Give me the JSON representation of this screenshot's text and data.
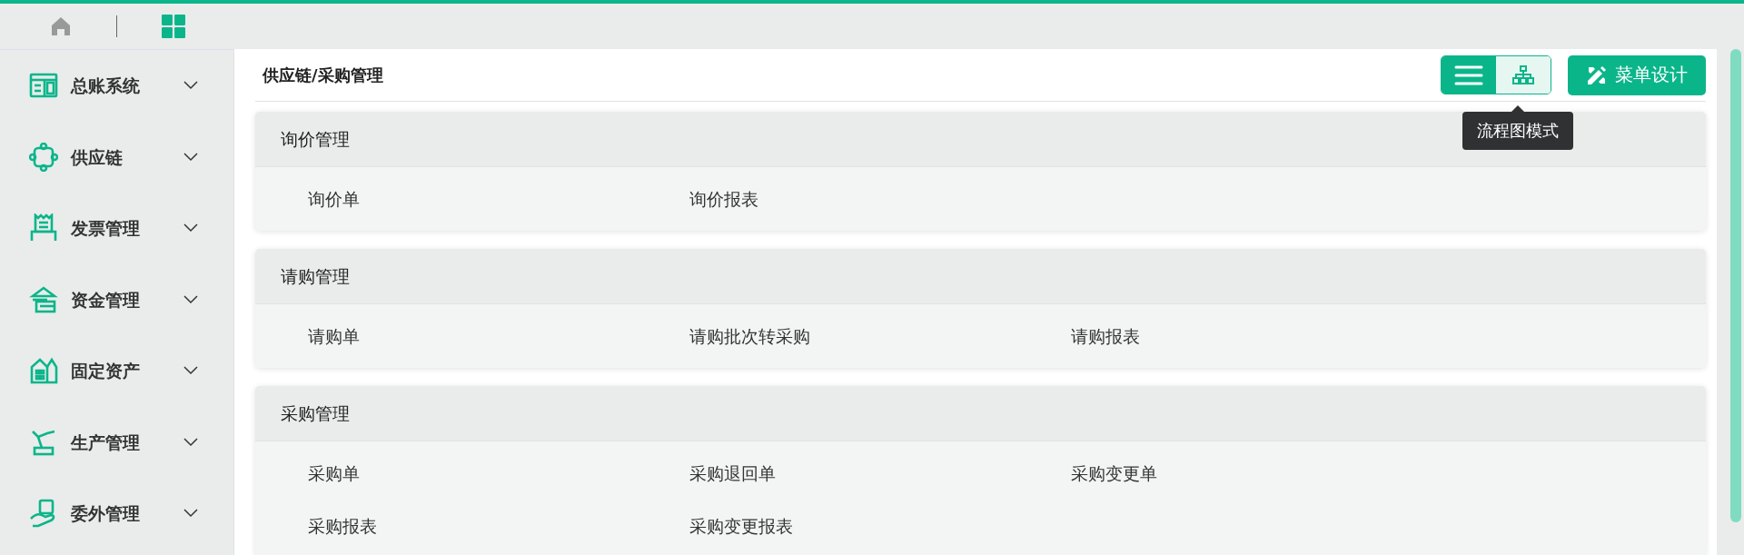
{
  "sidebar": {
    "items": [
      {
        "label": "总账系统",
        "kind": "ledger"
      },
      {
        "label": "供应链",
        "kind": "chain"
      },
      {
        "label": "发票管理",
        "kind": "invoice"
      },
      {
        "label": "资金管理",
        "kind": "bank"
      },
      {
        "label": "固定资产",
        "kind": "building"
      },
      {
        "label": "生产管理",
        "kind": "robot"
      },
      {
        "label": "委外管理",
        "kind": "hand"
      }
    ]
  },
  "breadcrumb": "供应链/采购管理",
  "view_modes": [
    {
      "kind": "list",
      "selected": true
    },
    {
      "kind": "flowchart",
      "selected": false
    }
  ],
  "tooltip": "流程图模式",
  "design_button": "菜单设计",
  "sections": [
    {
      "title": "询价管理",
      "items": [
        "询价单",
        "询价报表"
      ]
    },
    {
      "title": "请购管理",
      "items": [
        "请购单",
        "请购批次转采购",
        "请购报表"
      ]
    },
    {
      "title": "采购管理",
      "items": [
        "采购单",
        "采购退回单",
        "采购变更单",
        "采购报表",
        "采购变更报表"
      ]
    }
  ]
}
